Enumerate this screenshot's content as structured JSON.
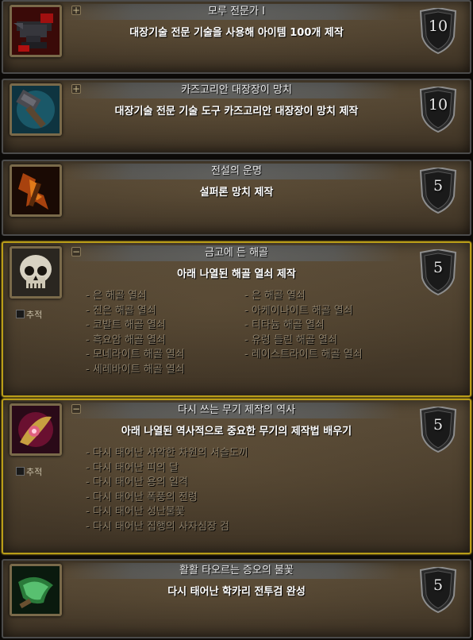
{
  "achievements": [
    {
      "title": "모루 전문가 I",
      "description": "대장기술 전문 기술을 사용해 아이템 100개 제작",
      "points": "10",
      "toggle": "+",
      "icon": "anvil-icon"
    },
    {
      "title": "카즈고리안 대장장이 망치",
      "description": "대장기술 전문 기술 도구 카즈고리안 대장장이 망치 제작",
      "points": "10",
      "toggle": "+",
      "icon": "hammer-icon"
    },
    {
      "title": "전설의 운명",
      "description": "설퍼론 망치 제작",
      "points": "5",
      "icon": "fire-hammer-icon"
    },
    {
      "title": "금고에 든 해골",
      "description": "아래 나열된 해골 열쇠 제작",
      "points": "5",
      "toggle": "−",
      "track_label": "추적",
      "icon": "skull-icon",
      "criteria_left": [
        "- 은 해골 열쇠",
        "- 진은 해골 열쇠",
        "- 코발트 해골 열쇠",
        "- 흑요암 해골 열쇠",
        "- 모네라이트 해골 열쇠",
        "- 세레바이트 해골 열쇠"
      ],
      "criteria_right": [
        "- 은 해골 열쇠",
        "- 아케이나이트 해골 열쇠",
        "- 티타늄 해골 열쇠",
        "- 유령 들린 해골 열쇠",
        "- 레이스트라이트 해골 열쇠"
      ]
    },
    {
      "title": "다시 쓰는 무기 제작의 역사",
      "description": "아래 나열된 역사적으로 중요한 무기의 제작법 배우기",
      "points": "5",
      "toggle": "−",
      "track_label": "추적",
      "icon": "weapon-icon",
      "criteria_left": [
        "- 다시 태어난 사악한 차원의 서슬도끼",
        "- 다시 태어난 피의 달",
        "- 다시 태어난 용의 일격",
        "- 다시 태어난 폭풍의 전령",
        "- 다시 태어난 성난불꽃",
        "- 다시 태어난 집행의 사자심장 검"
      ]
    },
    {
      "title": "활활 타오르는 증오의 불꽃",
      "description": "다시 태어난 학카리 전투검 완성",
      "points": "5",
      "icon": "green-blade-icon"
    }
  ]
}
